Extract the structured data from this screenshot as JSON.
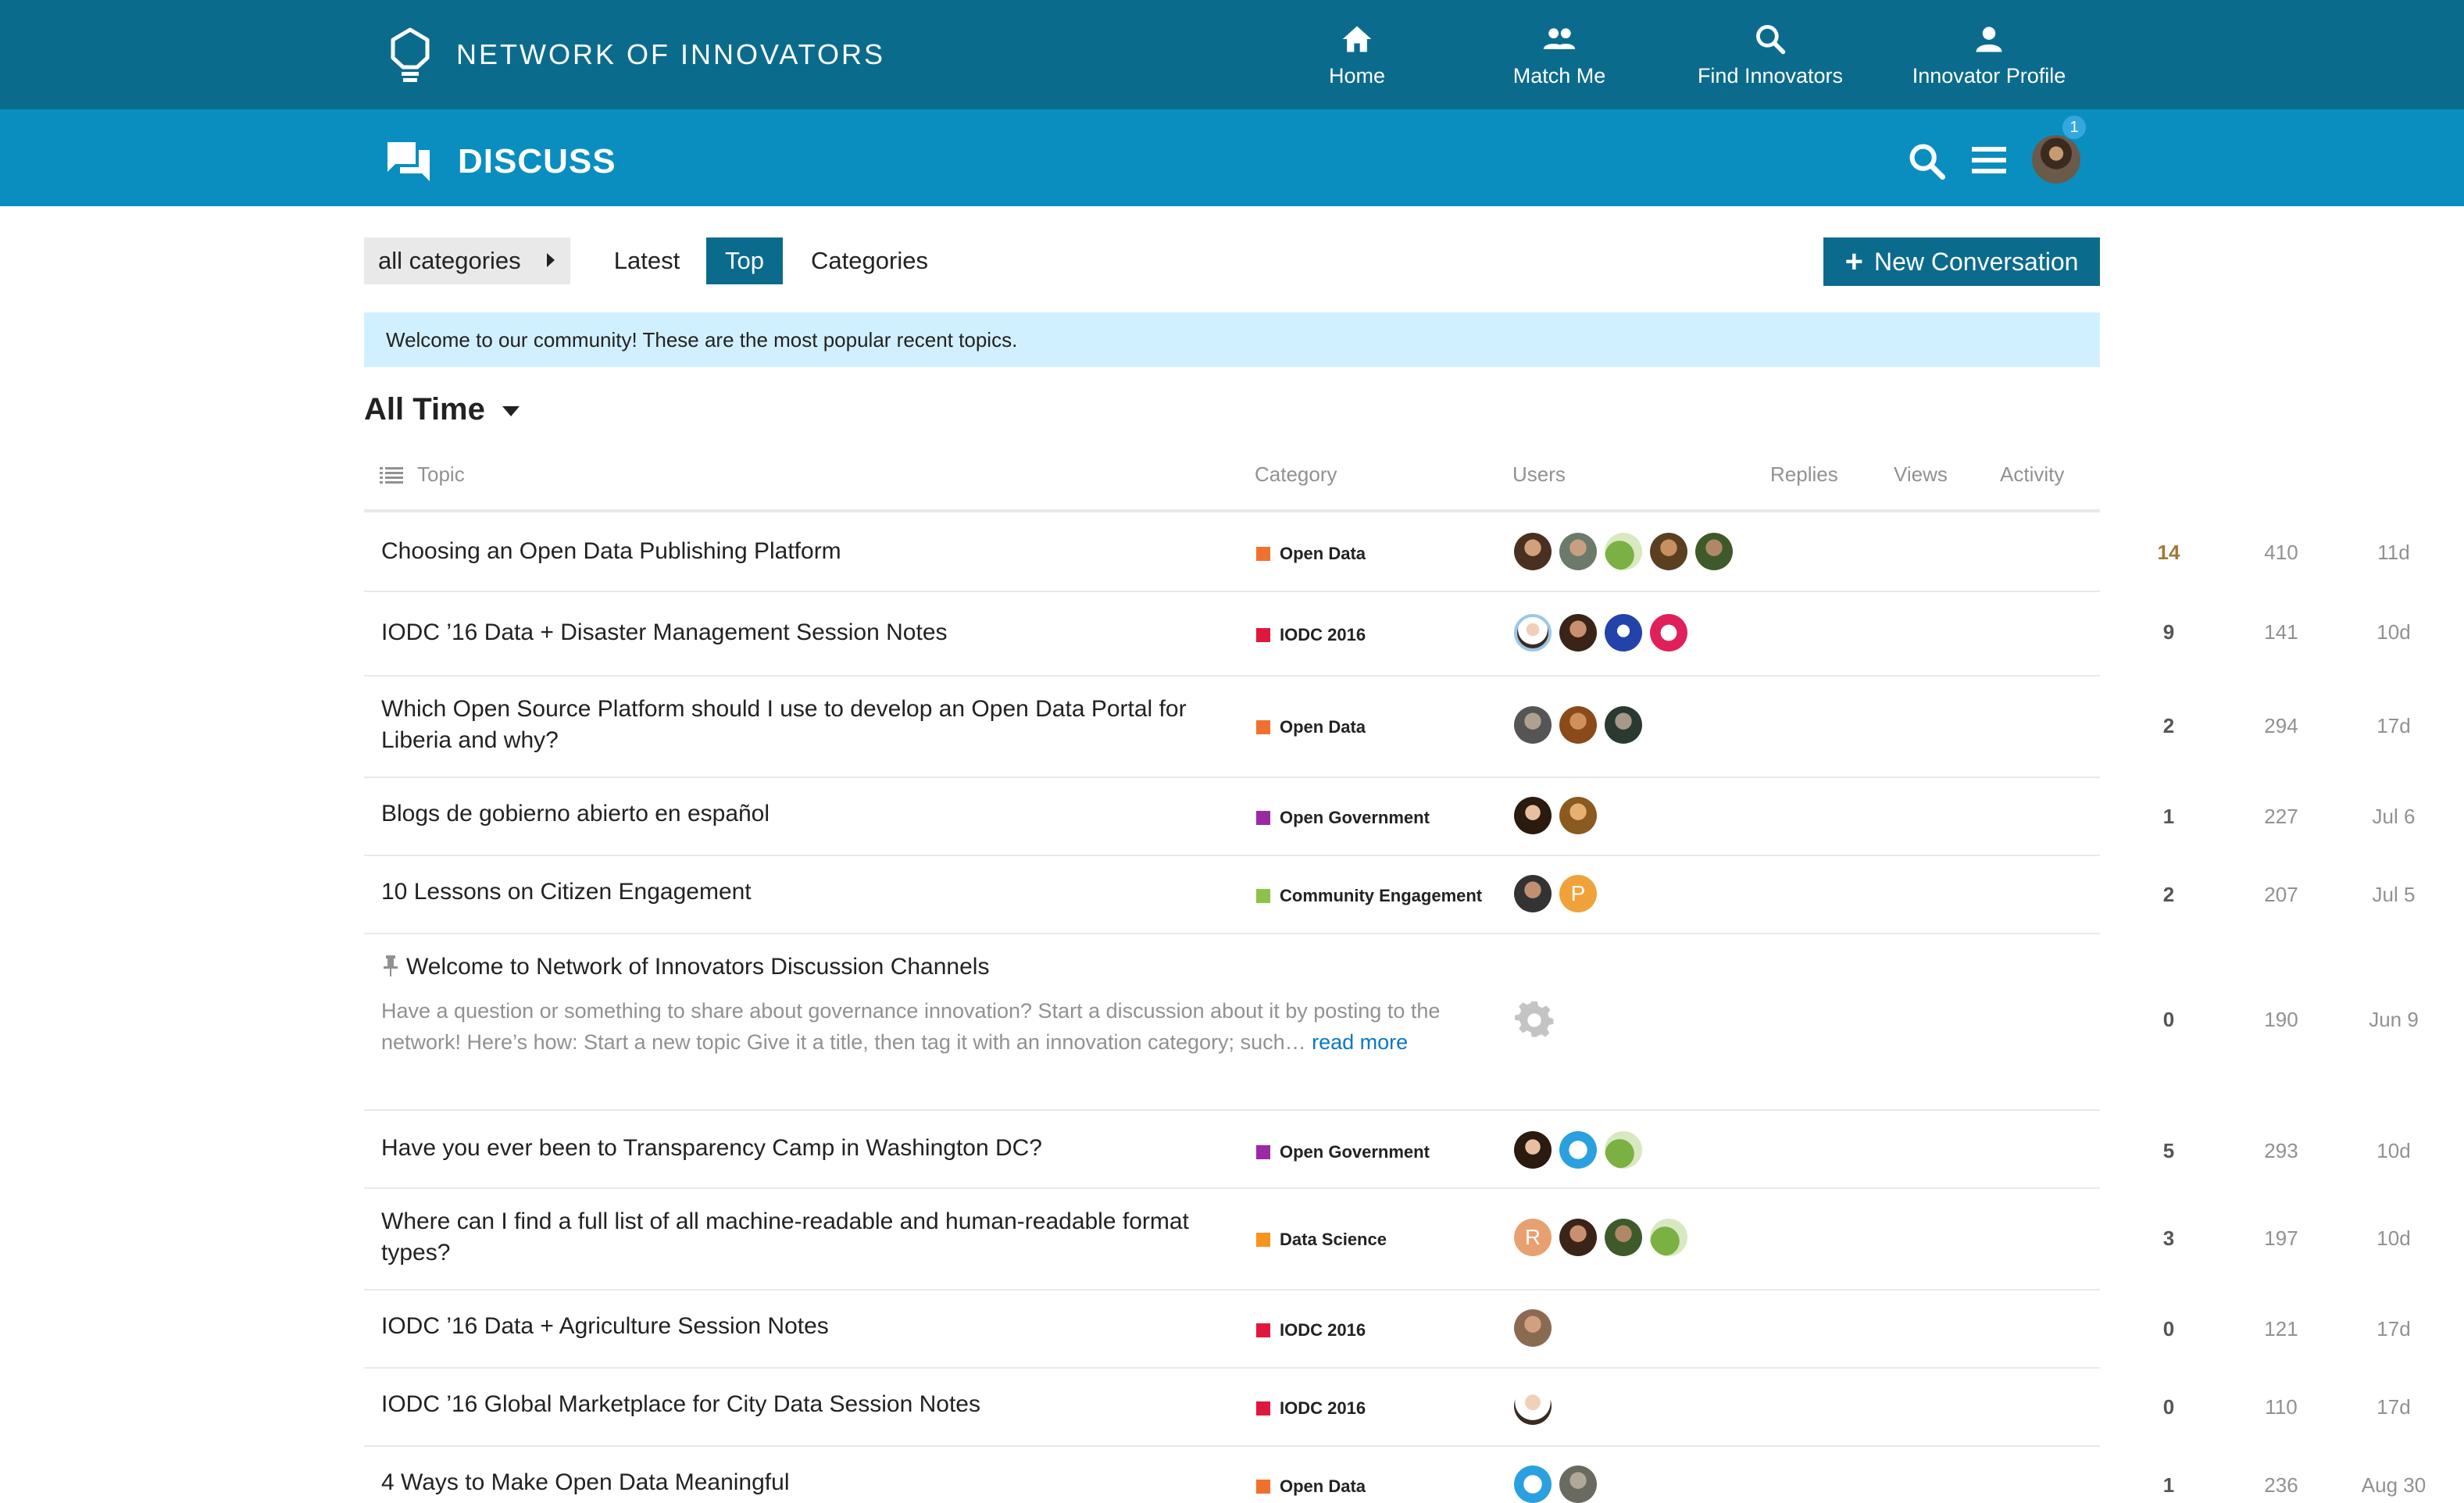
{
  "brand": {
    "name": "NETWORK OF INNOVATORS"
  },
  "top_nav": [
    {
      "label": "Home",
      "icon": "home-icon"
    },
    {
      "label": "Match Me",
      "icon": "people-icon"
    },
    {
      "label": "Find Innovators",
      "icon": "search-icon"
    },
    {
      "label": "Innovator Profile",
      "icon": "person-icon"
    }
  ],
  "discuss": {
    "title": "DISCUSS",
    "notification_count": "1"
  },
  "filters": {
    "category_dropdown": "all categories",
    "tabs": [
      "Latest",
      "Top",
      "Categories"
    ],
    "active_tab": "Top",
    "new_conversation": "New Conversation"
  },
  "banner": "Welcome to our community! These are the most popular recent topics.",
  "period": "All Time",
  "columns": {
    "topic": "Topic",
    "category": "Category",
    "users": "Users",
    "replies": "Replies",
    "views": "Views",
    "activity": "Activity"
  },
  "colors": {
    "top_bar": "#0b6b8d",
    "sub_bar": "#0a8ec0",
    "open_data": "#f0712e",
    "iodc_2016": "#e0173c",
    "open_government": "#9b2aa2",
    "community_engagement": "#8bc34a",
    "data_science": "#f7941d"
  },
  "topics": [
    {
      "title": "Choosing an Open Data Publishing Platform",
      "category": "Open Data",
      "replies": "14",
      "views": "410",
      "activity": "11d"
    },
    {
      "title": "IODC ’16 Data + Disaster Management Session Notes",
      "category": "IODC 2016",
      "replies": "9",
      "views": "141",
      "activity": "10d"
    },
    {
      "title": "Which Open Source Platform should I use to develop an Open Data Portal for Liberia and why?",
      "category": "Open Data",
      "replies": "2",
      "views": "294",
      "activity": "17d"
    },
    {
      "title": "Blogs de gobierno abierto en español",
      "category": "Open Government",
      "replies": "1",
      "views": "227",
      "activity": "Jul 6"
    },
    {
      "title": "10 Lessons on Citizen Engagement",
      "category": "Community Engagement",
      "replies": "2",
      "views": "207",
      "activity": "Jul 5"
    },
    {
      "title": "Welcome to Network of Innovators Discussion Channels",
      "excerpt": "Have a question or something to share about governance innovation? Start a discussion about it by posting to the network! Here’s how: Start a new topic Give it a title, then tag it with an innovation category; such…",
      "read_more": "read more",
      "replies": "0",
      "views": "190",
      "activity": "Jun 9"
    },
    {
      "title": "Have you ever been to Transparency Camp in Washington DC?",
      "category": "Open Government",
      "replies": "5",
      "views": "293",
      "activity": "10d"
    },
    {
      "title": "Where can I find a full list of all machine-readable and human-readable format types?",
      "category": "Data Science",
      "replies": "3",
      "views": "197",
      "activity": "10d"
    },
    {
      "title": "IODC ’16 Data + Agriculture Session Notes",
      "category": "IODC 2016",
      "replies": "0",
      "views": "121",
      "activity": "17d"
    },
    {
      "title": "IODC ’16 Global Marketplace for City Data Session Notes",
      "category": "IODC 2016",
      "replies": "0",
      "views": "110",
      "activity": "17d"
    },
    {
      "title": "4 Ways to Make Open Data Meaningful",
      "category": "Open Data",
      "replies": "1",
      "views": "236",
      "activity": "Aug 30"
    }
  ],
  "avatar_letters": {
    "P": "P",
    "R": "R"
  }
}
